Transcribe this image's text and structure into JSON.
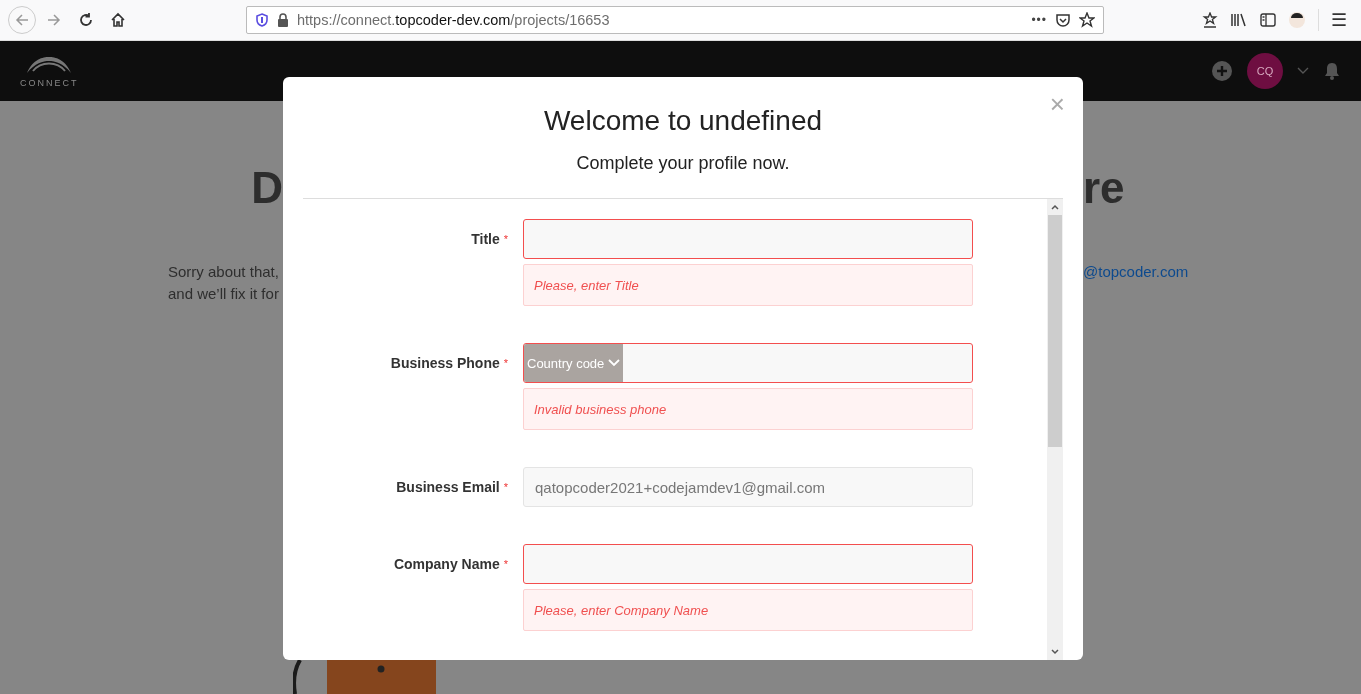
{
  "browser": {
    "url": {
      "scheme": "https://connect.",
      "domain": "topcoder-dev.com",
      "path": "/projects/16653"
    },
    "more": "•••",
    "menu": "☰"
  },
  "header": {
    "logo_text": "CONNECT",
    "avatar": "CQ"
  },
  "background": {
    "heading_start": "D",
    "heading_end": "re",
    "text_lines": [
      "Sorry about that,",
      "and we’ll fix it for"
    ],
    "link": "@topcoder.com"
  },
  "modal": {
    "title": "Welcome to undefined",
    "subtitle": "Complete your profile now.",
    "close": "×",
    "fields": [
      {
        "kind": "text",
        "label": "Title",
        "required_mark": "*",
        "invalid": true,
        "disabled": false,
        "error": "Please, enter Title"
      },
      {
        "kind": "phone",
        "label": "Business Phone",
        "required_mark": "*",
        "country_code": "Country code",
        "invalid": true,
        "disabled": false,
        "error": "Invalid business phone"
      },
      {
        "kind": "text",
        "label": "Business Email",
        "required_mark": "*",
        "value": "qatopcoder2021+codejamdev1@gmail.com",
        "invalid": false,
        "disabled": true
      },
      {
        "kind": "text",
        "label": "Company Name",
        "required_mark": "*",
        "invalid": true,
        "disabled": false,
        "error": "Please, enter Company Name"
      }
    ]
  }
}
